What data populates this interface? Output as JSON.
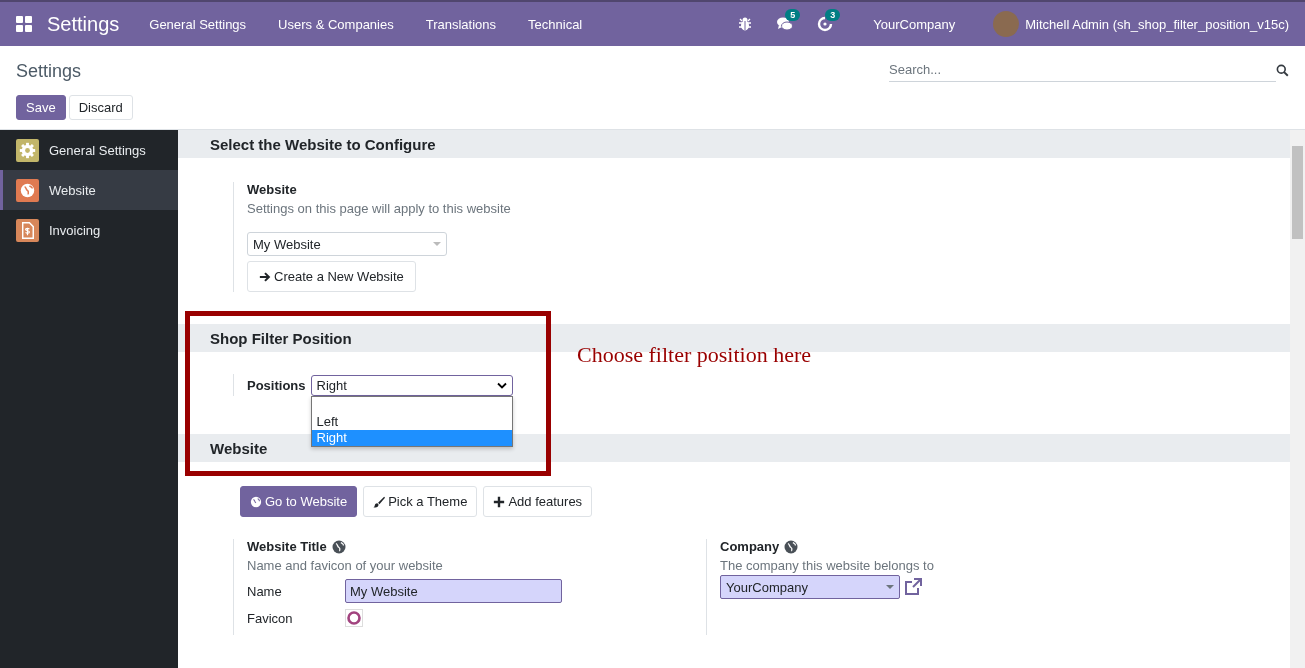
{
  "navbar": {
    "app_title": "Settings",
    "menus": [
      "General Settings",
      "Users & Companies",
      "Translations",
      "Technical"
    ],
    "systray": [
      {
        "kind": "bug"
      },
      {
        "kind": "chat",
        "badge": "5"
      },
      {
        "kind": "activity",
        "badge": "3"
      }
    ],
    "company": "YourCompany",
    "user": "Mitchell Admin (sh_shop_filter_position_v15c)"
  },
  "control_panel": {
    "breadcrumb": "Settings",
    "search": {
      "placeholder": "Search..."
    },
    "buttons": [
      {
        "label": "Save",
        "primary": true
      },
      {
        "label": "Discard",
        "primary": false
      }
    ]
  },
  "sidebar": {
    "items": [
      {
        "label": "General Settings",
        "selected": false,
        "kind": "gear",
        "color": "#c2b66a"
      },
      {
        "label": "Website",
        "selected": true,
        "kind": "globe",
        "color": "#e07a51"
      },
      {
        "label": "Invoicing",
        "selected": false,
        "kind": "invoice",
        "color": "#d7875a"
      }
    ]
  },
  "sections": [
    {
      "kind": "website_select",
      "title": "Select the Website to Configure",
      "setting_title": "Website",
      "description": "Settings on this page will apply to this website",
      "select_value": "My Website",
      "button": "Create a New Website"
    },
    {
      "kind": "filter_position",
      "title": "Shop Filter Position",
      "label": "Positions",
      "select_value": "Right",
      "dropdown": {
        "options": [
          {
            "label": "Left",
            "selected": false
          },
          {
            "label": "Right",
            "selected": true
          }
        ]
      }
    },
    {
      "kind": "website",
      "title": "Website",
      "buttons": [
        {
          "label": "Go to Website",
          "kind": "globe",
          "primary": true
        },
        {
          "label": "Pick a Theme",
          "kind": "brush",
          "primary": false
        },
        {
          "label": "Add features",
          "kind": "plus",
          "primary": false
        }
      ],
      "left": {
        "title": "Website Title",
        "description": "Name and favicon of your website",
        "fields": [
          {
            "label": "Name",
            "kind": "text",
            "value": "My Website"
          },
          {
            "label": "Favicon",
            "kind": "image"
          }
        ]
      },
      "right": {
        "title": "Company",
        "description": "The company this website belongs to",
        "select_value": "YourCompany"
      }
    }
  ],
  "annotation": {
    "text": "Choose filter position here"
  }
}
